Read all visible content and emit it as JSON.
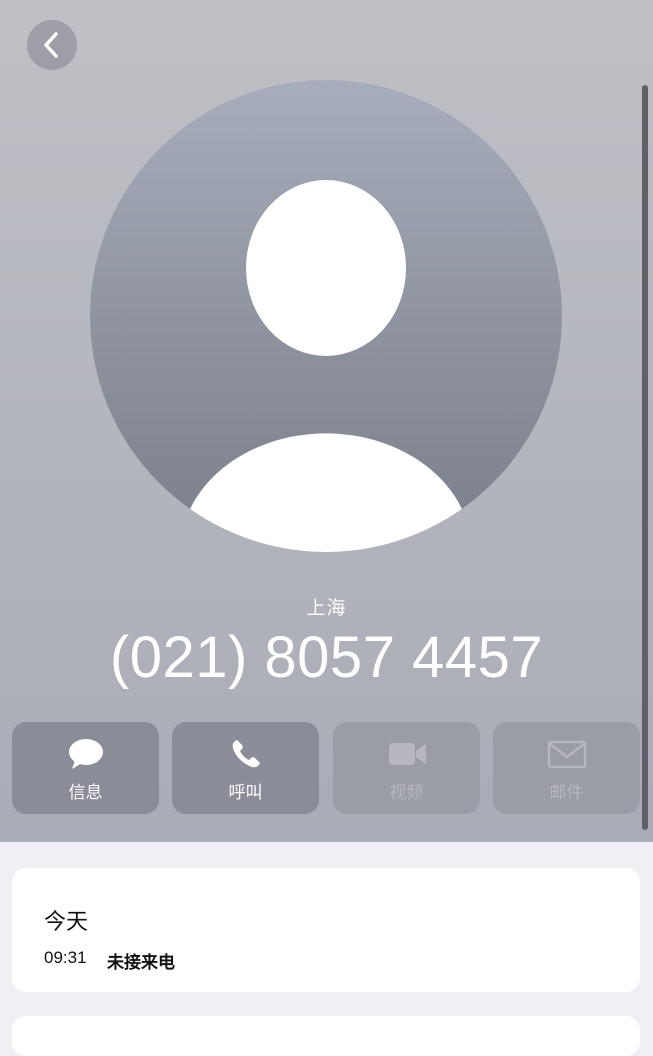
{
  "contact": {
    "location": "上海",
    "phone": "(021) 8057 4457"
  },
  "actions": [
    {
      "label": "信息",
      "icon": "message-bubble-icon",
      "enabled": true
    },
    {
      "label": "呼叫",
      "icon": "phone-icon",
      "enabled": true
    },
    {
      "label": "视频",
      "icon": "video-camera-icon",
      "enabled": false
    },
    {
      "label": "邮件",
      "icon": "envelope-icon",
      "enabled": false
    }
  ],
  "recents": {
    "day": "今天",
    "entries": [
      {
        "time": "09:31",
        "status": "未接来电"
      }
    ]
  },
  "colors": {
    "header_bg": "#b3b5bd",
    "action_bg": "#8a8c97",
    "avatar_bg": "#8d929e"
  }
}
